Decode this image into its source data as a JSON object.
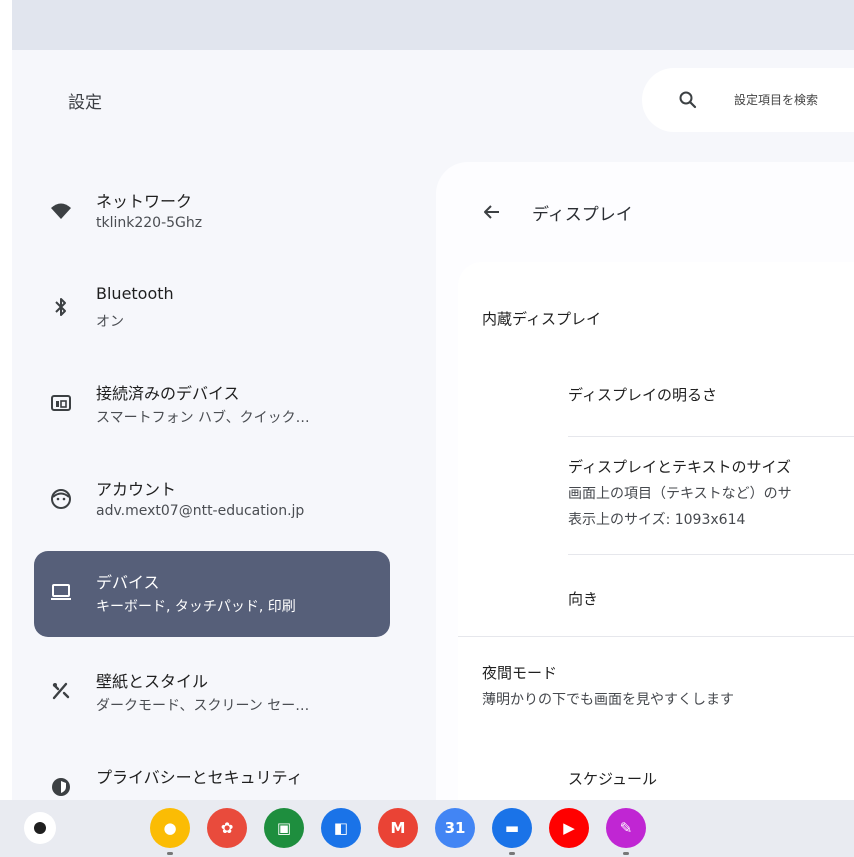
{
  "app": {
    "title": "設定"
  },
  "search": {
    "placeholder": "設定項目を検索"
  },
  "sidebar": {
    "items": [
      {
        "label": "ネットワーク",
        "sub": "tklink220-5Ghz",
        "icon": "wifi-icon"
      },
      {
        "label": "Bluetooth",
        "sub": "オン",
        "icon": "bluetooth-icon"
      },
      {
        "label": "接続済みのデバイス",
        "sub": "スマートフォン ハブ、クイック…",
        "icon": "connected-devices-icon"
      },
      {
        "label": "アカウント",
        "sub": "adv.mext07@ntt-education.jp",
        "icon": "account-icon"
      },
      {
        "label": "デバイス",
        "sub": "キーボード, タッチパッド, 印刷",
        "icon": "laptop-icon",
        "selected": true
      },
      {
        "label": "壁紙とスタイル",
        "sub": "ダークモード、スクリーン セー…",
        "icon": "palette-icon"
      },
      {
        "label": "プライバシーとセキュリティ",
        "sub": "",
        "icon": "shield-icon"
      }
    ]
  },
  "page": {
    "title": "ディスプレイ",
    "section_builtin": "内蔵ディスプレイ",
    "brightness": "ディスプレイの明るさ",
    "size_label": "ディスプレイとテキストのサイズ",
    "size_sub": "画面上の項目（テキストなど）のサ",
    "size_resolution": "表示上のサイズ: 1093x614",
    "orientation": "向き",
    "night_mode": "夜間モード",
    "night_mode_sub": "薄明かりの下でも画面を見やすくします",
    "schedule": "スケジュール"
  },
  "colors": {
    "selected_nav": "#565f79",
    "app_background": "#f6f7fb",
    "shelf": "#e9ebf1"
  },
  "shelf": {
    "apps": [
      {
        "name": "chrome-icon",
        "color": "#fbbc04"
      },
      {
        "name": "canvas-icon",
        "color": "#e94b3c"
      },
      {
        "name": "classroom-icon",
        "color": "#1e8e3e"
      },
      {
        "name": "docs-app-icon",
        "color": "#1a73e8"
      },
      {
        "name": "gmail-icon",
        "color": "#ea4335"
      },
      {
        "name": "calendar-icon",
        "color": "#4285f4"
      },
      {
        "name": "files-icon",
        "color": "#1a73e8"
      },
      {
        "name": "youtube-icon",
        "color": "#ff0000"
      },
      {
        "name": "notes-app-icon",
        "color": "#c026d3"
      }
    ]
  }
}
